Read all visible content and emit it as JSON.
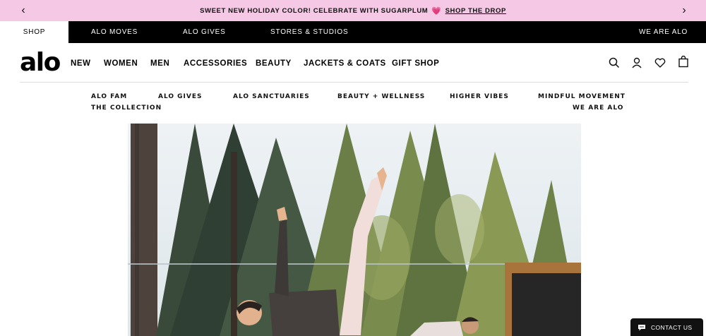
{
  "promo": {
    "text": "SWEET NEW HOLIDAY COLOR! CELEBRATE WITH SUGARPLUM",
    "heart": "💗",
    "link": "SHOP THE DROP",
    "prev_icon": "chevron-left-icon",
    "next_icon": "chevron-right-icon"
  },
  "topnav": {
    "shop": "SHOP",
    "alo_moves": "ALO MOVES",
    "alo_gives": "ALO GIVES",
    "stores": "STORES & STUDIOS",
    "we_are_alo": "WE ARE ALO"
  },
  "header": {
    "logo": "alo",
    "nav": {
      "new": "NEW",
      "women": "WOMEN",
      "men": "MEN",
      "accessories": "ACCESSORIES",
      "beauty": "BEAUTY",
      "jackets": "JACKETS & COATS",
      "gift_shop": "GIFT SHOP"
    },
    "icons": [
      "search-icon",
      "account-icon",
      "heart-icon",
      "bag-icon"
    ]
  },
  "subnav": {
    "alo_fam": "ALO FAM",
    "alo_gives": "ALO GIVES",
    "alo_sanctuaries": "ALO SANCTUARIES",
    "beauty_wellness": "BEAUTY + WELLNESS",
    "higher_vibes": "HIGHER VIBES",
    "mindful_movement": "MINDFUL MOVEMENT",
    "the_collection": "THE COLLECTION",
    "we_are_alo": "WE ARE ALO"
  },
  "contact": {
    "label": "CONTACT US",
    "icon": "chat-icon"
  },
  "colors": {
    "promo_bg": "#f5c8e6",
    "nav_bg": "#000000",
    "accent": "#e24b7a"
  }
}
